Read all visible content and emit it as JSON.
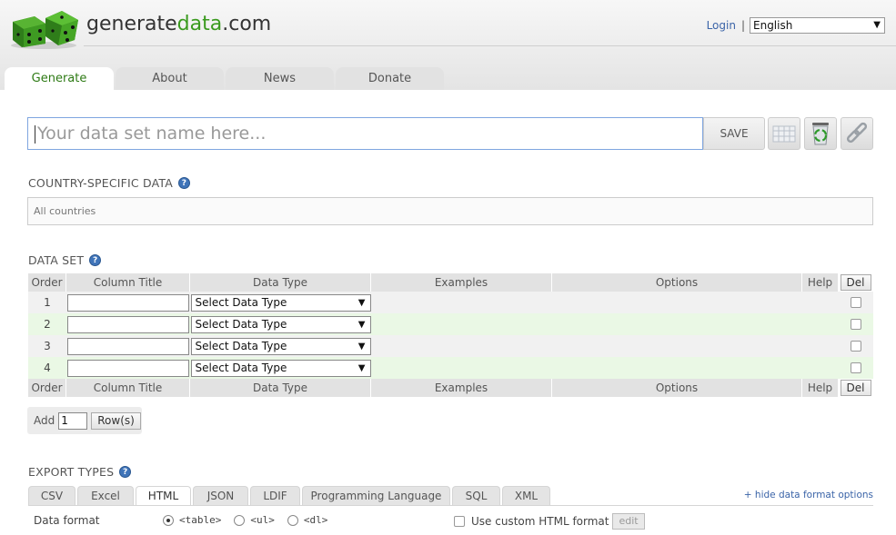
{
  "header": {
    "logo_main": "generate",
    "logo_accent": "data",
    "logo_suffix": ".com",
    "login_label": "Login",
    "separator": "|",
    "language": "English",
    "select_arrow": "▼"
  },
  "tabs": [
    {
      "label": "Generate",
      "active": true
    },
    {
      "label": "About",
      "active": false
    },
    {
      "label": "News",
      "active": false
    },
    {
      "label": "Donate",
      "active": false
    }
  ],
  "dataset_name": {
    "placeholder": "Your data set name here...",
    "save_label": "SAVE",
    "icons": [
      "grid-icon",
      "recycle-bin-icon",
      "link-icon"
    ]
  },
  "country": {
    "heading": "COUNTRY-SPECIFIC DATA",
    "value": "All countries"
  },
  "help_glyph": "?",
  "dataset": {
    "heading": "DATA SET",
    "columns": {
      "order": "Order",
      "title": "Column Title",
      "type": "Data Type",
      "examples": "Examples",
      "options": "Options",
      "help": "Help",
      "del": "Del"
    },
    "rows": [
      {
        "order": "1",
        "type": "Select Data Type"
      },
      {
        "order": "2",
        "type": "Select Data Type"
      },
      {
        "order": "3",
        "type": "Select Data Type"
      },
      {
        "order": "4",
        "type": "Select Data Type"
      }
    ],
    "add_label": "Add",
    "add_count": "1",
    "rows_button": "Row(s)"
  },
  "export": {
    "heading": "EXPORT TYPES",
    "tabs": [
      "CSV",
      "Excel",
      "HTML",
      "JSON",
      "LDIF",
      "Programming Language",
      "SQL",
      "XML"
    ],
    "active_tab": "HTML",
    "hide_options": "+ hide data format options",
    "data_format_label": "Data format",
    "formats": [
      "<table>",
      "<ul>",
      "<dl>"
    ],
    "selected_format": "<table>",
    "custom_label": "Use custom HTML format",
    "edit_label": "edit"
  },
  "colors": {
    "accent_green": "#3a9a1e",
    "link_blue": "#3b64a8",
    "row_green": "#eaf8e5"
  }
}
